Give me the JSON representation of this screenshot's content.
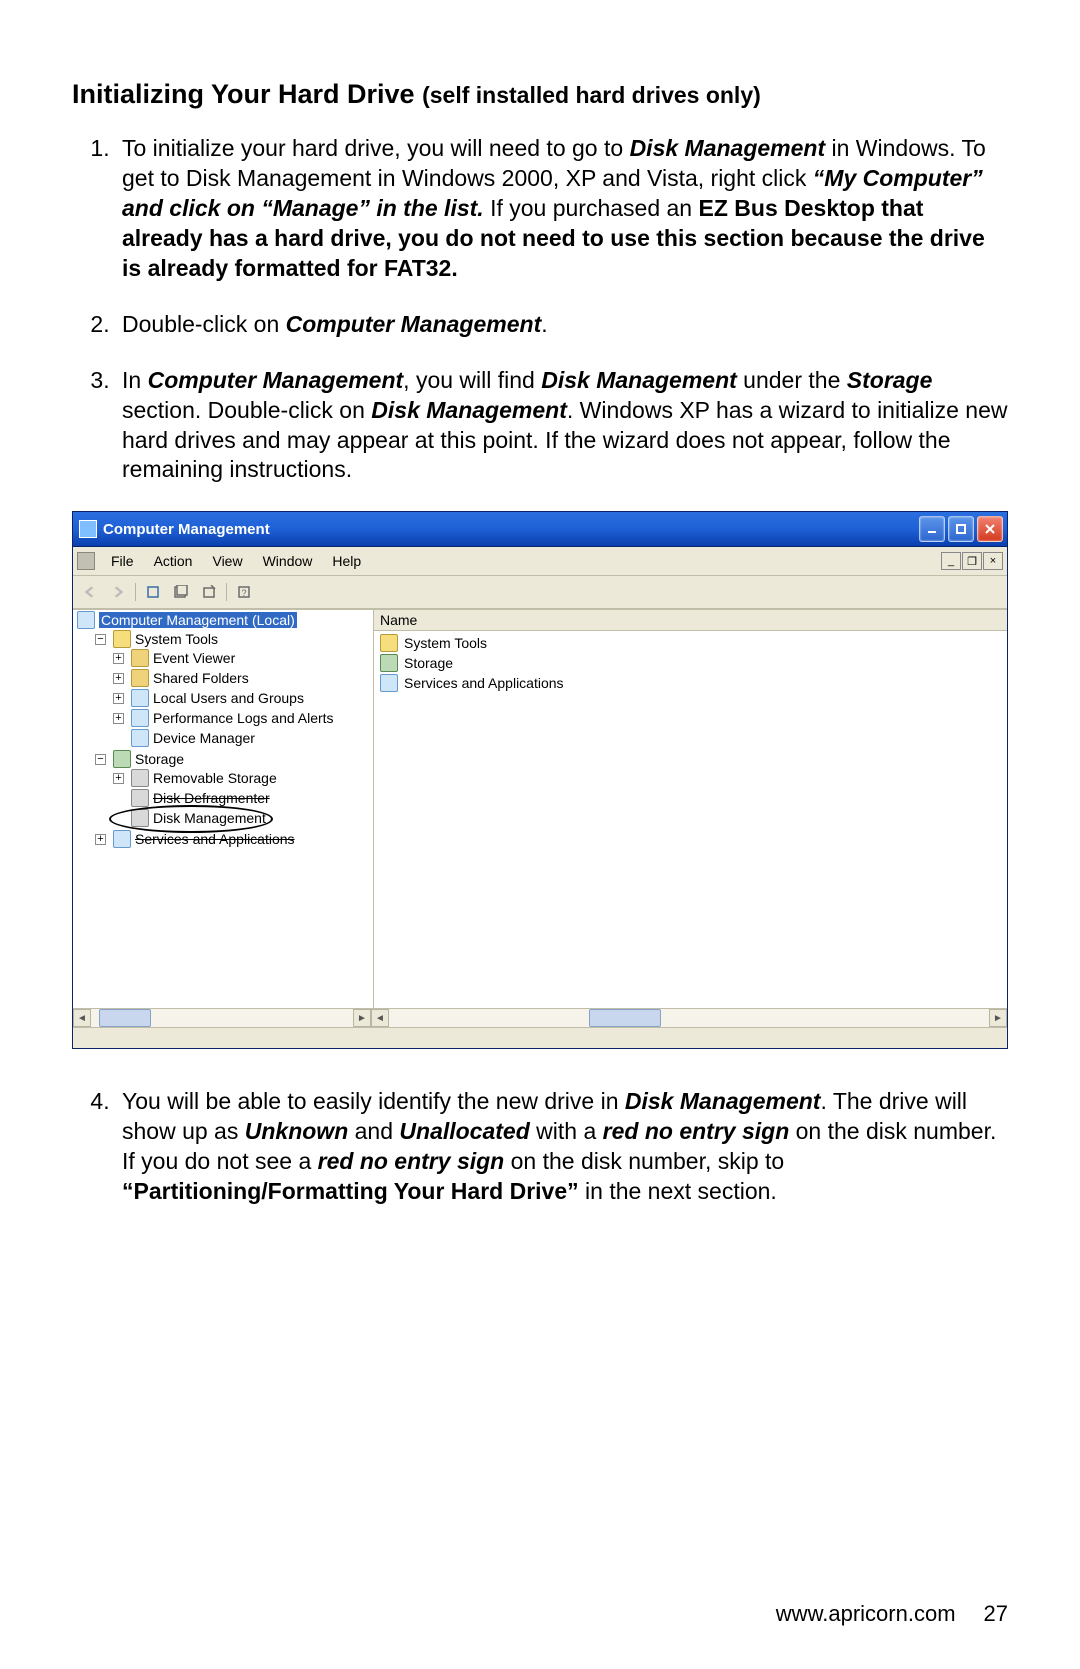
{
  "heading": {
    "main": "Initializing Your Hard Drive ",
    "sub": "(self installed hard drives only)"
  },
  "steps": {
    "s1": {
      "a": "To initialize your hard drive, you will need to go to ",
      "b": "Disk Management",
      "c": " in Windows.  To get to Disk Management in Windows 2000, XP and Vista, right click ",
      "d": "“My Computer” and click on “Manage” in the list.",
      "e": " If you purchased an ",
      "f": "EZ Bus Desktop that already has a hard drive, you do not need to use this section because the drive is already formatted for FAT32."
    },
    "s2": {
      "a": "Double-click on ",
      "b": "Computer Management",
      "c": "."
    },
    "s3": {
      "a": "In ",
      "b": "Computer Management",
      "c": ", you will find ",
      "d": "Disk Management",
      "e": " under the ",
      "f": "Storage",
      "g": " section. Double-click on ",
      "h": "Disk Management",
      "i": ".  Windows XP has a wizard to initialize new hard drives and may appear at this point.  If the wizard does not appear, follow the remaining instructions."
    },
    "s4": {
      "a": "You will be able to easily identify the new drive in ",
      "b": "Disk Management",
      "c": ".  The drive will show up as ",
      "d": "Unknown",
      "e": " and ",
      "f": "Unallocated",
      "g": " with a ",
      "h": "red no entry sign",
      "i": " on the disk number.  If you do not see a ",
      "j": "red no entry sign",
      "k": " on the disk number, skip to ",
      "l": "“Partitioning/Formatting Your Hard Drive”",
      "m": " in the next section."
    }
  },
  "window": {
    "title": "Computer Management",
    "menus": [
      "File",
      "Action",
      "View",
      "Window",
      "Help"
    ],
    "list_header": "Name",
    "list_items": [
      "System Tools",
      "Storage",
      "Services and Applications"
    ],
    "tree": {
      "root": "Computer Management (Local)",
      "system_tools": "System Tools",
      "event_viewer": "Event Viewer",
      "shared_folders": "Shared Folders",
      "local_users": "Local Users and Groups",
      "perf_logs": "Performance Logs and Alerts",
      "device_manager": "Device Manager",
      "storage": "Storage",
      "removable": "Removable Storage",
      "defrag": "Disk Defragmenter",
      "disk_mgmt": "Disk Management",
      "services": "Services and Applications"
    }
  },
  "footer": {
    "url": "www.apricorn.com",
    "page": "27"
  }
}
